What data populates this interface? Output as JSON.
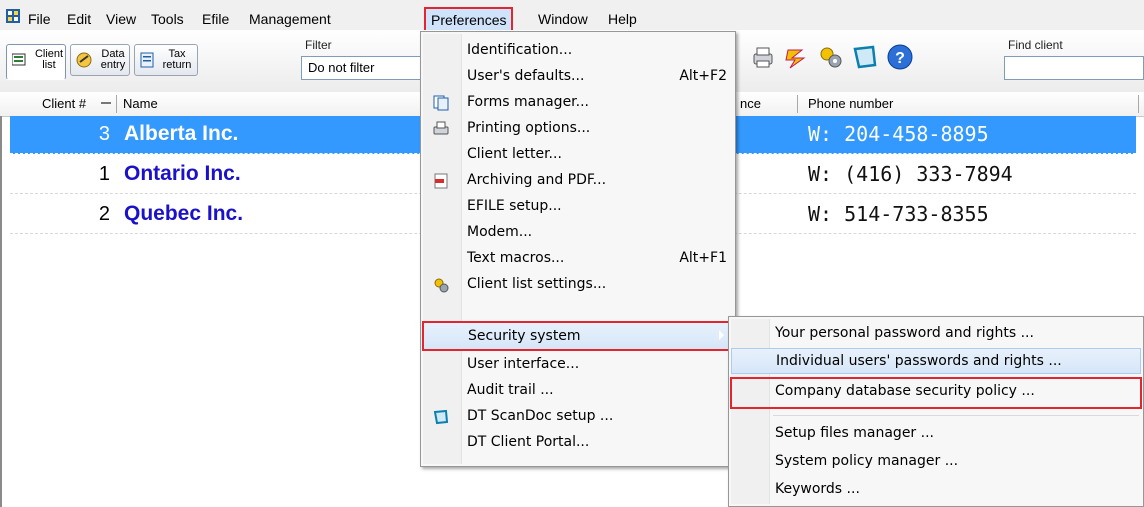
{
  "menubar": {
    "items": [
      {
        "label": "File"
      },
      {
        "label": "Edit"
      },
      {
        "label": "View"
      },
      {
        "label": "Tools"
      },
      {
        "label": "Efile"
      },
      {
        "label": "Management"
      },
      {
        "label": "Preferences"
      },
      {
        "label": "Window"
      },
      {
        "label": "Help"
      }
    ]
  },
  "toolbar": {
    "buttons": [
      {
        "label": "Client list",
        "icon": "client-list-icon"
      },
      {
        "label": "Data entry",
        "icon": "data-entry-icon"
      },
      {
        "label": "Tax return",
        "icon": "tax-return-icon"
      }
    ],
    "filter_label": "Filter",
    "filter_value": "Do not filter",
    "find_label": "Find client",
    "find_value": ""
  },
  "columns": {
    "client_num": "Client #",
    "name": "Name",
    "partial": "nce",
    "phone": "Phone number"
  },
  "clients": [
    {
      "num": "3",
      "name": "Alberta Inc.",
      "phone": "W: 204-458-8895"
    },
    {
      "num": "1",
      "name": "Ontario Inc.",
      "phone": "W: (416) 333-7894"
    },
    {
      "num": "2",
      "name": "Quebec Inc.",
      "phone": "W: 514-733-8355"
    }
  ],
  "preferences_menu": {
    "items": [
      {
        "label": "Identification...",
        "shortcut": ""
      },
      {
        "label": "User's defaults...",
        "shortcut": "Alt+F2"
      },
      {
        "label": "Forms manager...",
        "shortcut": ""
      },
      {
        "label": "Printing options...",
        "shortcut": ""
      },
      {
        "label": "Client letter...",
        "shortcut": ""
      },
      {
        "label": "Archiving and PDF...",
        "shortcut": ""
      },
      {
        "label": "EFILE setup...",
        "shortcut": ""
      },
      {
        "label": "Modem...",
        "shortcut": ""
      },
      {
        "label": "Text macros...",
        "shortcut": "Alt+F1"
      },
      {
        "label": "Client list settings...",
        "shortcut": ""
      },
      {
        "label": "Security system",
        "shortcut": ""
      },
      {
        "label": "User interface...",
        "shortcut": ""
      },
      {
        "label": "Audit trail ...",
        "shortcut": ""
      },
      {
        "label": "DT ScanDoc setup ...",
        "shortcut": ""
      },
      {
        "label": "DT Client Portal...",
        "shortcut": ""
      }
    ]
  },
  "security_submenu": {
    "items": [
      {
        "label": "Your personal password and rights ..."
      },
      {
        "label": "Individual users' passwords and rights ..."
      },
      {
        "label": "Company database security policy ..."
      },
      {
        "label": "Setup files manager ..."
      },
      {
        "label": "System policy manager ..."
      },
      {
        "label": "Keywords ..."
      }
    ]
  },
  "colors": {
    "selection": "#3399ff",
    "client_name": "#1a11c9",
    "annotation_red": "#e3262e",
    "menu_highlight": "#d6e6f8"
  }
}
